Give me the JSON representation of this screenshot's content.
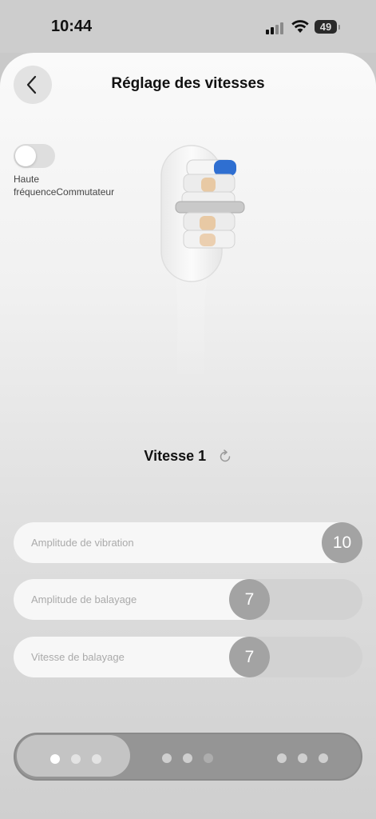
{
  "status": {
    "time": "10:44",
    "battery": "49"
  },
  "header": {
    "title": "Réglage des vitesses"
  },
  "toggle": {
    "label": "Haute fréquenceCommutateur",
    "on": false
  },
  "speed": {
    "label": "Vitesse 1"
  },
  "sliders": [
    {
      "label": "Amplitude de vibration",
      "value": "10",
      "fraction": 1.0
    },
    {
      "label": "Amplitude de balayage",
      "value": "7",
      "fraction": 0.7
    },
    {
      "label": "Vitesse de balayage",
      "value": "7",
      "fraction": 0.7
    }
  ],
  "modes": {
    "selected_index": 0,
    "count": 3
  },
  "colors": {
    "accent_blue": "#2f6fd1",
    "knob": "#a3a3a3"
  }
}
